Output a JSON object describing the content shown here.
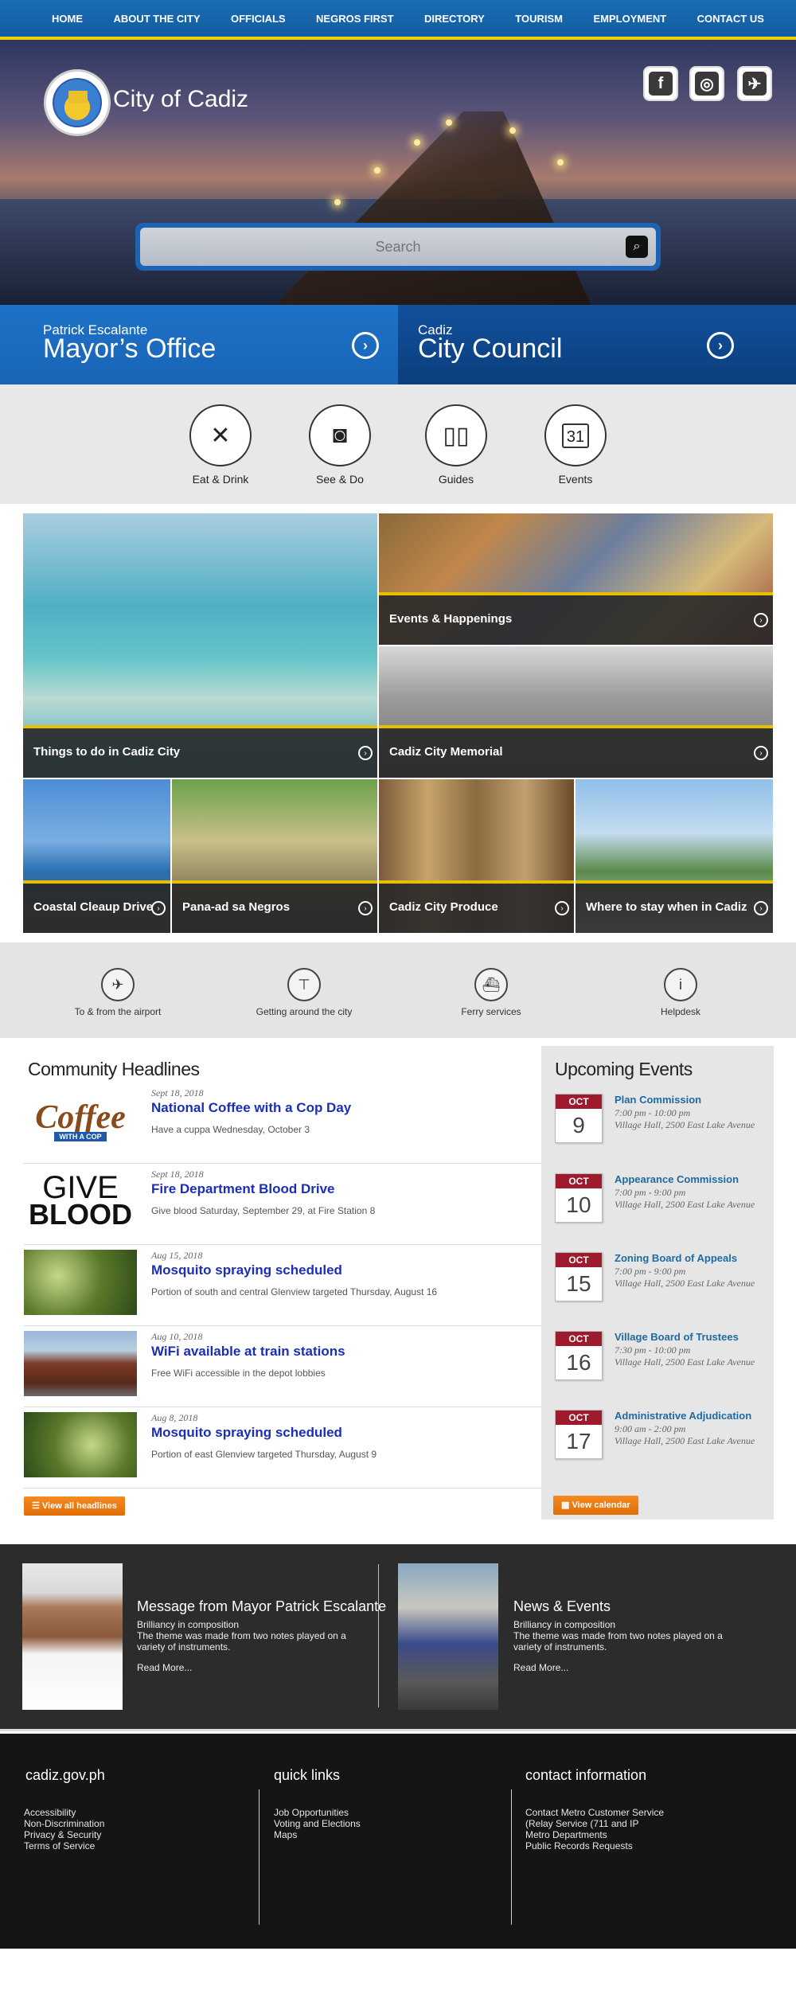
{
  "nav": [
    "HOME",
    "ABOUT THE CITY",
    "OFFICIALS",
    "NEGROS FIRST",
    "DIRECTORY",
    "TOURISM",
    "EMPLOYMENT",
    "CONTACT US"
  ],
  "hero": {
    "city_name": "City of Cadiz",
    "search_placeholder": "Search",
    "social_icons": [
      "facebook-icon",
      "instagram-icon",
      "twitter-icon"
    ],
    "slides": 5
  },
  "offices": {
    "mayor": {
      "sub": "Patrick Escalante",
      "title": "Mayor’s Office"
    },
    "council": {
      "sub": "Cadiz",
      "title": "City Council"
    }
  },
  "quick_links": [
    {
      "label": "Eat & Drink",
      "icon": "fork-knife-icon"
    },
    {
      "label": "See & Do",
      "icon": "camera-icon"
    },
    {
      "label": "Guides",
      "icon": "book-icon"
    },
    {
      "label": "Events",
      "icon": "calendar-icon",
      "day": "31"
    }
  ],
  "tiles": [
    "Things to do in Cadiz City",
    "Events & Happenings",
    "Cadiz City Memorial",
    "Coastal Cleaup Drive",
    "Pana-ad sa Negros",
    "Cadiz City Produce",
    "Where to stay when in Cadiz"
  ],
  "help": [
    {
      "label": "To & from the airport",
      "icon": "airplane-icon"
    },
    {
      "label": "Getting around the city",
      "icon": "signpost-icon"
    },
    {
      "label": "Ferry services",
      "icon": "ship-icon"
    },
    {
      "label": "Helpdesk",
      "icon": "info-icon"
    }
  ],
  "headlines": {
    "title": "Community Headlines",
    "items": [
      {
        "date": "Sept 18, 2018",
        "title": "National Coffee with a Cop Day",
        "desc": "Have a cuppa Wednesday, October 3",
        "thumb_text": "Coffee",
        "thumb_sub": "WITH A COP"
      },
      {
        "date": "Sept 18, 2018",
        "title": "Fire Department Blood Drive",
        "desc": "Give blood Saturday, September 29, at Fire Station 8",
        "thumb_text": "GIVE",
        "thumb_sub": "BLOOD"
      },
      {
        "date": "Aug 15, 2018",
        "title": "Mosquito spraying scheduled",
        "desc": "Portion of south and central Glenview targeted Thursday, August 16"
      },
      {
        "date": "Aug 10, 2018",
        "title": "WiFi available at train stations",
        "desc": "Free WiFi accessible in the depot lobbies"
      },
      {
        "date": "Aug 8, 2018",
        "title": "Mosquito spraying scheduled",
        "desc": "Portion of east Glenview targeted Thursday, August 9"
      }
    ],
    "button": "View all headlines"
  },
  "events": {
    "title": "Upcoming Events",
    "items": [
      {
        "month": "OCT",
        "day": "9",
        "title": "Plan Commission",
        "time": "7:00 pm - 10:00 pm",
        "place": "Village Hall, 2500 East Lake Avenue"
      },
      {
        "month": "OCT",
        "day": "10",
        "title": "Appearance Commission",
        "time": "7:00 pm - 9:00 pm",
        "place": "Village Hall, 2500 East Lake Avenue"
      },
      {
        "month": "OCT",
        "day": "15",
        "title": "Zoning Board of Appeals",
        "time": "7:00 pm - 9:00 pm",
        "place": "Village Hall, 2500 East Lake Avenue"
      },
      {
        "month": "OCT",
        "day": "16",
        "title": "Village Board of Trustees",
        "time": "7:30 pm - 10:00 pm",
        "place": "Village Hall, 2500 East Lake Avenue"
      },
      {
        "month": "OCT",
        "day": "17",
        "title": "Administrative Adjudication",
        "time": "9:00 am - 2:00 pm",
        "place": "Village Hall, 2500 East Lake Avenue"
      }
    ],
    "button": "View calendar"
  },
  "feature": {
    "mayor": {
      "title": "Message from Mayor Patrick Escalante",
      "line1": "Brilliancy in composition",
      "line2": "The theme was made from two notes played on a variety of instruments.",
      "read": "Read More..."
    },
    "news": {
      "title": "News & Events",
      "line1": "Brilliancy in composition",
      "line2": "The theme was made from two notes played on a variety of instruments.",
      "read": "Read More..."
    }
  },
  "footer": {
    "col1": {
      "title": "cadiz.gov.ph",
      "links": [
        "Accessibility",
        "Non-Discrimination",
        "Privacy & Security",
        "Terms of Service"
      ]
    },
    "col2": {
      "title": "quick links",
      "links": [
        "Job Opportunities",
        "Voting and Elections",
        "Maps"
      ]
    },
    "col3": {
      "title": "contact information",
      "links": [
        "Contact Metro Customer Service",
        "(Relay Service (711 and IP",
        "Metro Departments",
        "Public Records Requests"
      ]
    }
  },
  "colors": {
    "nav": "#1b6cb3",
    "accent_yellow": "#e6c000",
    "mayor_blue": "#1e72c8",
    "council_blue": "#0b3f7e",
    "headline_link": "#1a2eb8",
    "event_link": "#1f6aa2",
    "calendar_red": "#9e1b2e",
    "button_orange": "#f58a1f"
  }
}
